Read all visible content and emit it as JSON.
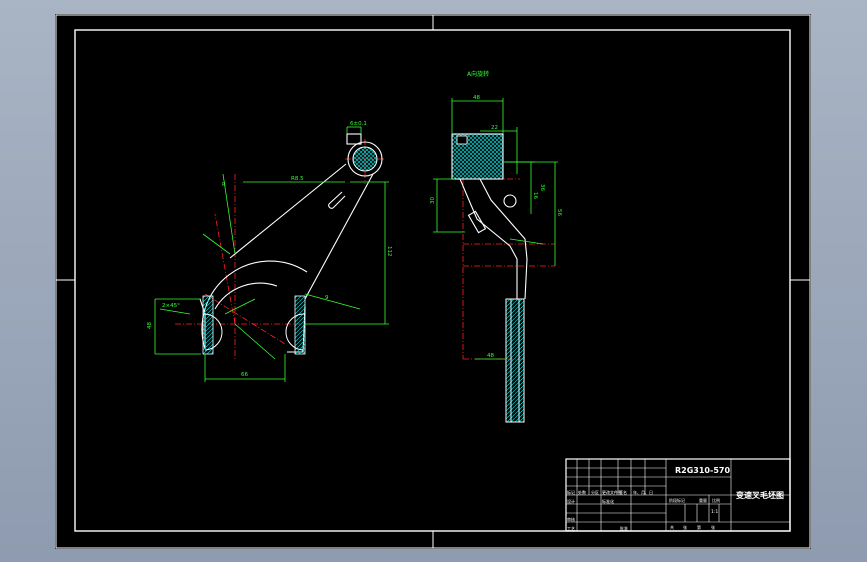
{
  "drawing": {
    "section_label": "A向旋转",
    "left_view": {
      "dims": {
        "top_slot": "6±0.1",
        "radius_top": "R8.5",
        "angle_label": "R",
        "vertical": "112",
        "diagonal": "9",
        "chamfer": "2×45°",
        "width_left": "48",
        "width_bottom": "66"
      }
    },
    "right_view": {
      "dims": {
        "top_width": "48",
        "inner": "22",
        "right_h1": "16",
        "right_h2": "36",
        "right_h3": "56",
        "left_dim": "30",
        "bottom_dim": "48"
      }
    }
  },
  "title_block": {
    "drawing_no": "R2G310-570",
    "part_name": "变速叉毛坯图",
    "scale": "1:1",
    "row_labels": [
      "标记",
      "处数",
      "分区",
      "更改文件号",
      "签名",
      "年、月、日"
    ],
    "sign_labels": [
      "设计",
      "标准化",
      "审核",
      "工艺",
      "批准"
    ],
    "stage_labels": [
      "阶段标记",
      "重量",
      "比例"
    ],
    "footer_labels": [
      "共",
      "张",
      "第",
      "张"
    ]
  }
}
